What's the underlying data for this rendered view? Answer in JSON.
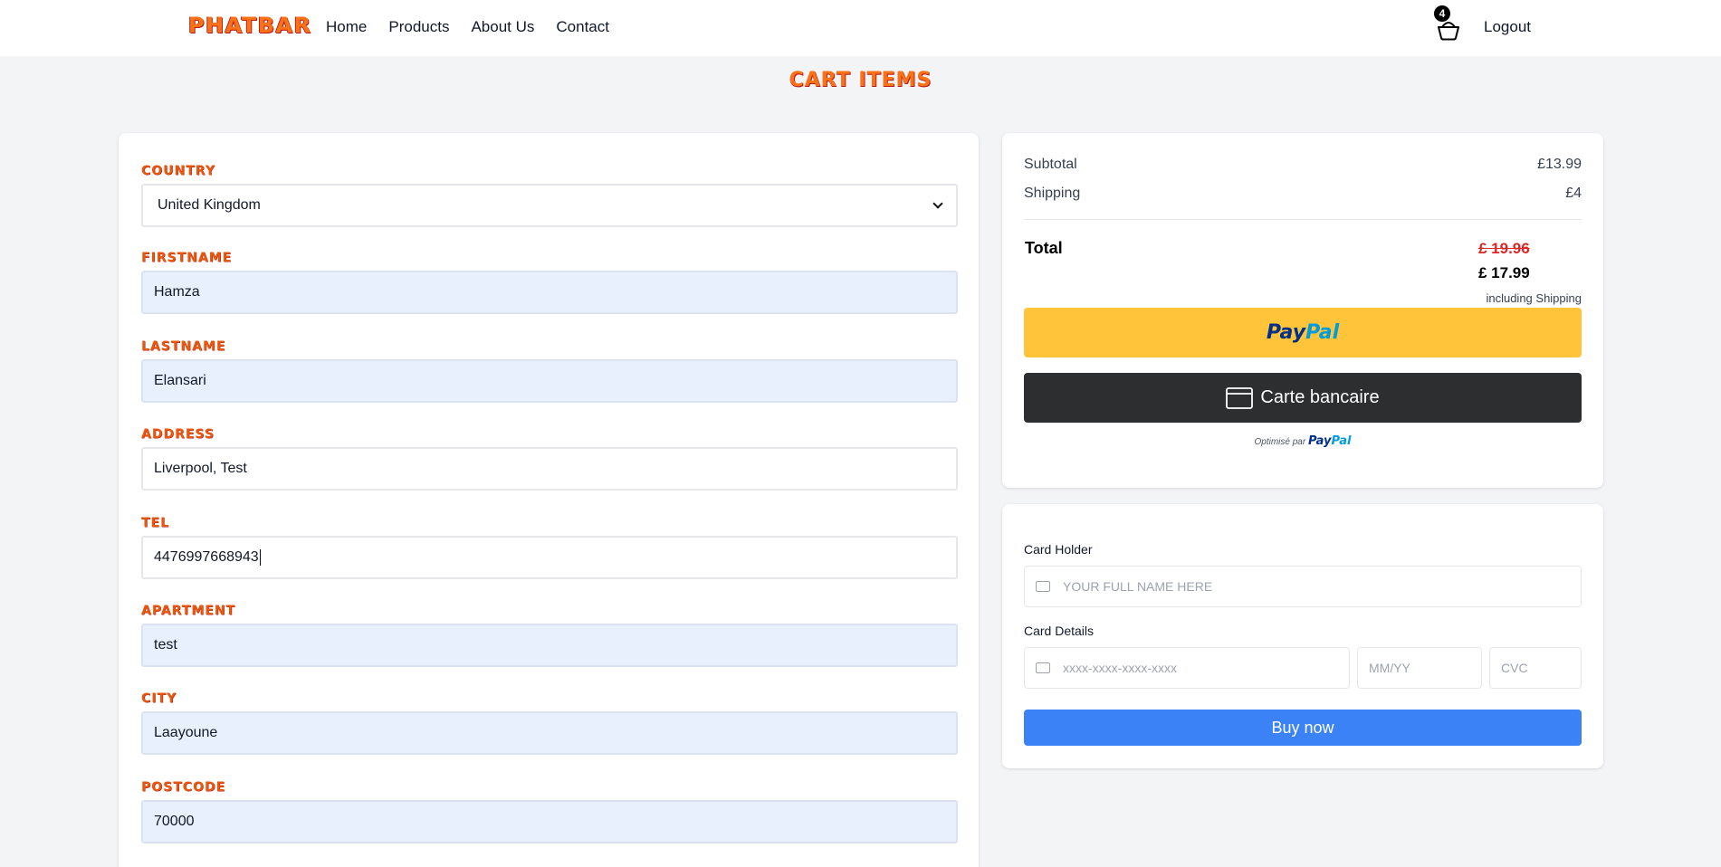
{
  "nav": {
    "brand": "PHATBAR",
    "links": [
      "Home",
      "Products",
      "About Us",
      "Contact"
    ],
    "cart_count": "4",
    "logout": "Logout"
  },
  "page": {
    "title": "Cart Items"
  },
  "form": {
    "country": {
      "label": "Country",
      "value": "United Kingdom"
    },
    "firstname": {
      "label": "Firstname",
      "value": "Hamza"
    },
    "lastname": {
      "label": "Lastname",
      "value": "Elansari"
    },
    "address": {
      "label": "Address",
      "value": "Liverpool, Test"
    },
    "tel": {
      "label": "Tel",
      "value": "4476997668943"
    },
    "apartment": {
      "label": "Apartment",
      "value": "test"
    },
    "city": {
      "label": "City",
      "value": "Laayoune"
    },
    "postcode": {
      "label": "Postcode",
      "value": "70000"
    }
  },
  "summary": {
    "subtotal_label": "Subtotal",
    "subtotal_value": "£13.99",
    "shipping_label": "Shipping",
    "shipping_value": "£4",
    "total_label": "Total",
    "old_total": "£ 19.96",
    "new_total": "£ 17.99",
    "including_shipping": "including Shipping",
    "paypal_label_a": "Pay",
    "paypal_label_b": "Pal",
    "card_button_label": "Carte bancaire",
    "powered_by": "Optimisé par",
    "powered_brand_a": "Pay",
    "powered_brand_b": "Pal"
  },
  "payment": {
    "card_holder_label": "Card Holder",
    "card_holder_placeholder": "YOUR FULL NAME HERE",
    "card_details_label": "Card Details",
    "card_number_placeholder": "xxxx-xxxx-xxxx-xxxx",
    "expiry_placeholder": "MM/YY",
    "cvc_placeholder": "CVC",
    "buy_label": "Buy now"
  },
  "colors": {
    "brand_orange": "#f97316",
    "paypal_yellow": "#ffc439",
    "card_dark": "#2c2e2f",
    "buy_blue": "#3b82f6",
    "autofill_blue": "#e8f0fe"
  }
}
